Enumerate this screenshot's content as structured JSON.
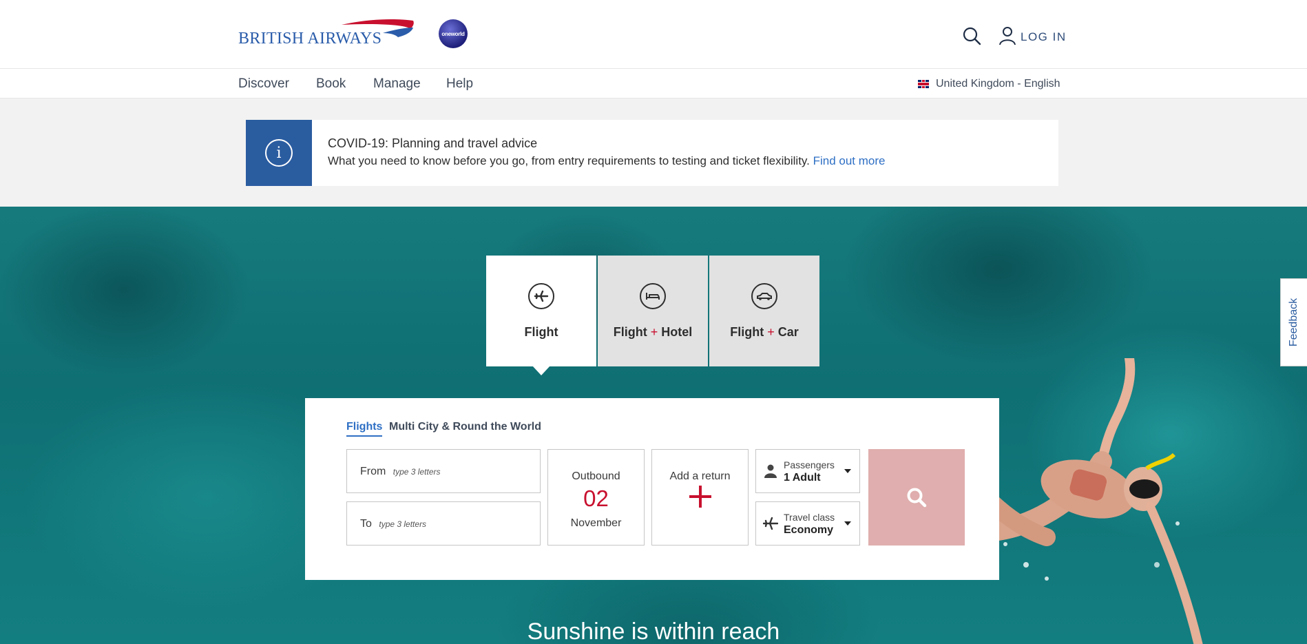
{
  "header": {
    "logo_text": "BRITISH AIRWAYS",
    "alliance_badge": "oneworld",
    "login_label": "LOG IN",
    "icons": [
      "search-icon",
      "user-icon"
    ]
  },
  "nav": {
    "items": [
      "Discover",
      "Book",
      "Manage",
      "Help"
    ],
    "locale": "United Kingdom - English"
  },
  "covid_banner": {
    "title": "COVID-19: Planning and travel advice",
    "text": "What you need to know before you go, from entry requirements to testing and ticket flexibility.",
    "link": "Find out more",
    "icon": "i"
  },
  "product_tabs": [
    {
      "label": "Flight",
      "icon": "plane-icon",
      "active": true
    },
    {
      "label_a": "Flight",
      "plus": "+",
      "label_b": "Hotel",
      "icon": "bed-icon",
      "active": false
    },
    {
      "label_a": "Flight",
      "plus": "+",
      "label_b": "Car",
      "icon": "car-icon",
      "active": false
    }
  ],
  "search": {
    "tabs": [
      "Flights",
      "Multi City & Round the World"
    ],
    "active_tab": "Flights",
    "from_label": "From",
    "from_placeholder": "type 3 letters",
    "to_label": "To",
    "to_placeholder": "type 3 letters",
    "outbound_label": "Outbound",
    "outbound_day": "02",
    "outbound_month": "November",
    "return_label": "Add a return",
    "passengers_label": "Passengers",
    "passengers_value": "1 Adult",
    "class_label": "Travel class",
    "class_value": "Economy"
  },
  "hero": {
    "tagline": "Sunshine is within reach"
  },
  "feedback_label": "Feedback",
  "colors": {
    "brand_blue": "#2a5ca0",
    "link_blue": "#2e6fc4",
    "accent_red": "#c8102e",
    "search_button": "#e0aeae",
    "sea": "#137e80"
  }
}
